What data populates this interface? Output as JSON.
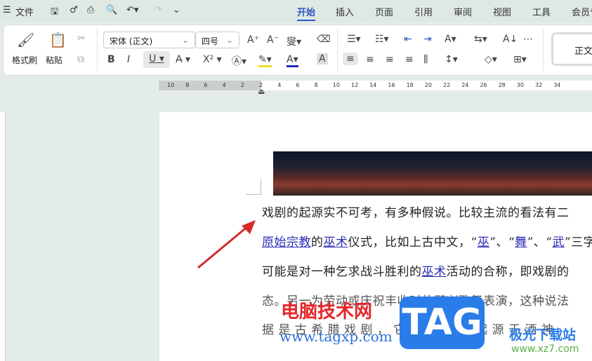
{
  "titlebar": {
    "menu_icon": "☰",
    "file": "文件",
    "quick": [
      "save-icon",
      "share-icon",
      "print-icon",
      "preview-icon",
      "undo-icon",
      "redo-icon",
      "more-icon"
    ]
  },
  "tabs": [
    "开始",
    "插入",
    "页面",
    "引用",
    "审阅",
    "视图",
    "工具",
    "会员专享"
  ],
  "ribbon": {
    "format_painter": "格式刷",
    "paste": "粘贴",
    "font_name": "宋体 (正文)",
    "font_size": "四号",
    "style_preview": "正文",
    "bold": "B",
    "italic": "I",
    "underline": "U",
    "superscript": "X²"
  },
  "ruler": [
    "10",
    "8",
    "6",
    "4",
    "2",
    "2",
    "4",
    "6",
    "8",
    "10",
    "12",
    "14",
    "16",
    "18",
    "20",
    "22",
    "24",
    "26",
    "28",
    "30",
    "32",
    "34"
  ],
  "document": {
    "lines": [
      [
        {
          "t": "戏剧的起源实不可考，有多种假说。比较主流的看法有二"
        }
      ],
      [
        {
          "t": "原始宗教",
          "link": true
        },
        {
          "t": "的"
        },
        {
          "t": "巫术",
          "link": true
        },
        {
          "t": "仪式，比如上古中文，“"
        },
        {
          "t": "巫",
          "link": true
        },
        {
          "t": "”、“"
        },
        {
          "t": "舞",
          "link": true
        },
        {
          "t": "”、“"
        },
        {
          "t": "武",
          "link": true
        },
        {
          "t": "”三字"
        }
      ],
      [
        {
          "t": "可能是对一种乞求战斗胜利的"
        },
        {
          "t": "巫术",
          "link": true
        },
        {
          "t": "活动的合称，即戏剧的"
        }
      ],
      [
        {
          "t": "态。另一为劳动或庆祝丰收时的即兴歌舞表演，这种说法"
        }
      ],
      [
        {
          "t": "据 是 古 希 腊 戏 剧 ， 它 被 认 为 是 起 源 于 酒 神"
        }
      ]
    ]
  },
  "watermarks": {
    "site_name": "电脑技术网",
    "site_url": "www.tagxp.com",
    "tag": "TAG",
    "xz7_name": "极光下载站",
    "xz7_url": "www.xz7.com"
  },
  "colors": {
    "accent": "#2a56c6",
    "link": "#2b2bb5",
    "arrow": "#d42a2a"
  }
}
